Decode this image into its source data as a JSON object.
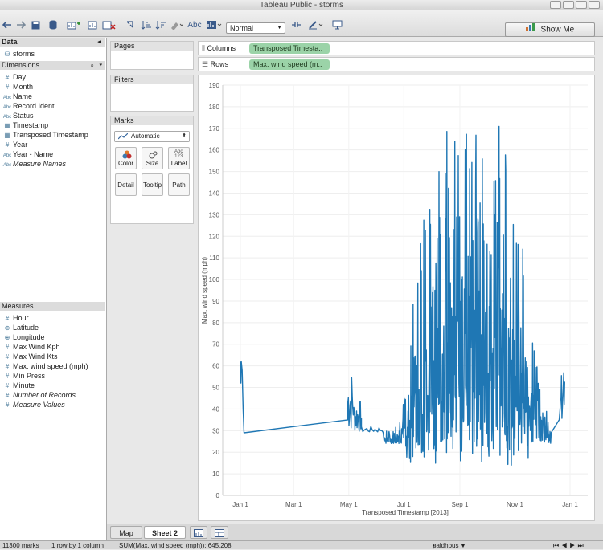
{
  "window": {
    "title": "Tableau Public - storms"
  },
  "toolbar": {
    "mark_size_select": "Normal",
    "abc_label": "Abc",
    "show_me_label": "Show Me"
  },
  "data_pane": {
    "header": "Data",
    "datasource": "storms",
    "dimensions_header": "Dimensions",
    "dimensions": [
      {
        "label": "Day",
        "icon": "#"
      },
      {
        "label": "Month",
        "icon": "#"
      },
      {
        "label": "Name",
        "icon": "Abc"
      },
      {
        "label": "Record Ident",
        "icon": "Abc"
      },
      {
        "label": "Status",
        "icon": "Abc"
      },
      {
        "label": "Timestamp",
        "icon": "cal"
      },
      {
        "label": "Transposed Timestamp",
        "icon": "cal"
      },
      {
        "label": "Year",
        "icon": "#"
      },
      {
        "label": "Year - Name",
        "icon": "Abc"
      },
      {
        "label": "Measure Names",
        "icon": "Abc"
      }
    ],
    "measures_header": "Measures",
    "measures": [
      {
        "label": "Hour",
        "icon": "#"
      },
      {
        "label": "Latitude",
        "icon": "globe"
      },
      {
        "label": "Longitude",
        "icon": "globe"
      },
      {
        "label": "Max Wind Kph",
        "icon": "#"
      },
      {
        "label": "Max Wind Kts",
        "icon": "#"
      },
      {
        "label": "Max. wind speed (mph)",
        "icon": "#"
      },
      {
        "label": "Min Press",
        "icon": "#"
      },
      {
        "label": "Minute",
        "icon": "#"
      },
      {
        "label": "Number of Records",
        "icon": "#"
      },
      {
        "label": "Measure Values",
        "icon": "#"
      }
    ]
  },
  "cards": {
    "pages": "Pages",
    "filters": "Filters",
    "marks": "Marks",
    "marks_type": "Automatic",
    "buttons": [
      "Color",
      "Size",
      "Label",
      "Detail",
      "Tooltip",
      "Path"
    ]
  },
  "shelves": {
    "columns_label": "Columns",
    "columns_pill": "Transposed Timesta..",
    "rows_label": "Rows",
    "rows_pill": "Max. wind speed (m.."
  },
  "chart_data": {
    "type": "line",
    "xlabel": "Transposed Timestamp [2013]",
    "ylabel": "Max. wind speed (mph)",
    "x_ticks": [
      "Jan 1",
      "Mar 1",
      "May 1",
      "Jul 1",
      "Sep 1",
      "Nov 1",
      "Jan 1"
    ],
    "ylim": [
      0,
      190
    ],
    "y_ticks": [
      0,
      10,
      20,
      30,
      40,
      50,
      60,
      70,
      80,
      90,
      100,
      110,
      120,
      130,
      140,
      150,
      160,
      170,
      180,
      190
    ],
    "grid": true,
    "series_color": "#1f77b4",
    "x_unit": "day_of_year",
    "x": [
      1,
      2,
      3,
      4,
      5,
      120,
      121,
      125,
      130,
      160,
      170,
      180,
      190,
      200,
      210,
      220,
      230,
      240,
      250,
      260,
      270,
      280,
      290,
      300,
      310,
      320,
      330,
      340,
      345,
      350,
      355,
      360
    ],
    "y": [
      62,
      52,
      60,
      40,
      29,
      35,
      58,
      44,
      29,
      30,
      30,
      40,
      80,
      130,
      140,
      150,
      173,
      168,
      173,
      170,
      160,
      150,
      183,
      140,
      140,
      80,
      62,
      40,
      29,
      30,
      35,
      58
    ]
  },
  "sheet_tabs": [
    "Map",
    "Sheet 2"
  ],
  "status": {
    "marks": "11300 marks",
    "rows_cols": "1 row by 1 column",
    "sum": "SUM(Max. wind speed (mph)): 645,208",
    "user": "paldhous"
  }
}
